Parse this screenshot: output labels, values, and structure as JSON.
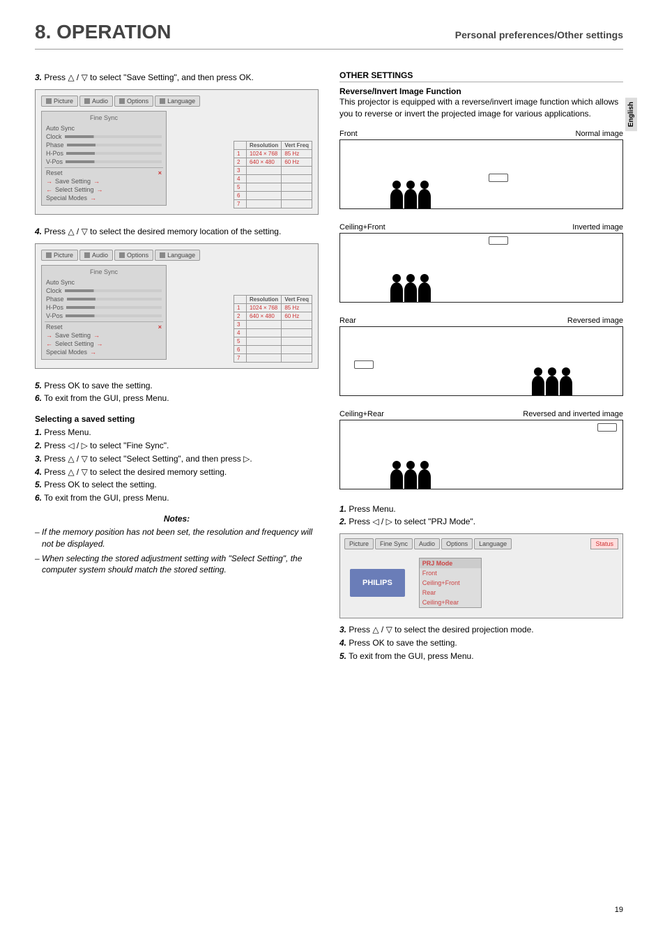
{
  "header": {
    "chapter": "8. OPERATION",
    "section": "Personal preferences/Other settings"
  },
  "side_tab": "English",
  "left": {
    "step3": {
      "num": "3.",
      "text": "Press △ / ▽ to select \"Save Setting\", and then press OK."
    },
    "step4": {
      "num": "4.",
      "text": "Press △ / ▽ to select the desired memory location of the setting."
    },
    "step5": {
      "num": "5.",
      "text": "Press OK to save the setting."
    },
    "step6": {
      "num": "6.",
      "text": "To exit from the GUI, press Menu."
    },
    "selecting_heading": "Selecting a saved setting",
    "sel1": {
      "num": "1.",
      "text": "Press Menu."
    },
    "sel2": {
      "num": "2.",
      "text": "Press ◁ / ▷ to select \"Fine Sync\"."
    },
    "sel3": {
      "num": "3.",
      "text": "Press △ / ▽ to select \"Select Setting\", and then press ▷."
    },
    "sel4": {
      "num": "4.",
      "text": "Press △ / ▽ to select the desired memory setting."
    },
    "sel5": {
      "num": "5.",
      "text": "Press OK to select the setting."
    },
    "sel6": {
      "num": "6.",
      "text": "To exit from the GUI, press Menu."
    },
    "notes_title": "Notes:",
    "note1": "– If the memory position has not been set, the resolution and frequency will not be displayed.",
    "note2": "– When selecting the stored adjustment setting with \"Select Setting\", the computer system should match the stored setting."
  },
  "osd": {
    "tabs": [
      "Picture",
      "Audio",
      "Options",
      "Language"
    ],
    "panel_title": "Fine Sync",
    "rows": [
      "Auto Sync",
      "Clock",
      "Phase",
      "H-Pos",
      "V-Pos",
      "Reset",
      "Save Setting",
      "Select Setting",
      "Special Modes"
    ],
    "res_headers": [
      "Resolution",
      "Vert Freq"
    ],
    "res_rows": [
      {
        "n": "1",
        "res": "1024 × 768",
        "freq": "85 Hz"
      },
      {
        "n": "2",
        "res": "640 × 480",
        "freq": "60 Hz"
      },
      {
        "n": "3",
        "res": "",
        "freq": ""
      },
      {
        "n": "4",
        "res": "",
        "freq": ""
      },
      {
        "n": "5",
        "res": "",
        "freq": ""
      },
      {
        "n": "6",
        "res": "",
        "freq": ""
      },
      {
        "n": "7",
        "res": "",
        "freq": ""
      }
    ]
  },
  "right": {
    "other_heading": "OTHER SETTINGS",
    "reverse_heading": "Reverse/Invert Image Function",
    "reverse_desc": "This projector is equipped with a reverse/invert image function which allows you to reverse or invert the projected image for various applications.",
    "modes": [
      {
        "left": "Front",
        "right": "Normal image"
      },
      {
        "left": "Ceiling+Front",
        "right": "Inverted image"
      },
      {
        "left": "Rear",
        "right": "Reversed image"
      },
      {
        "left": "Ceiling+Rear",
        "right": "Reversed and inverted image"
      }
    ],
    "r1": {
      "num": "1.",
      "text": "Press Menu."
    },
    "r2": {
      "num": "2.",
      "text": "Press ◁ / ▷ to select \"PRJ Mode\"."
    },
    "r3": {
      "num": "3.",
      "text": "Press △ / ▽ to select the desired projection mode."
    },
    "r4": {
      "num": "4.",
      "text": "Press OK to save the setting."
    },
    "r5": {
      "num": "5.",
      "text": "To exit from the GUI, press Menu."
    }
  },
  "osd2": {
    "tabs": [
      "Picture",
      "Fine Sync",
      "Audio",
      "Options",
      "Language"
    ],
    "status": "Status",
    "logo": "PHILIPS",
    "menu_title": "PRJ Mode",
    "menu_items": [
      "Front",
      "Ceiling+Front",
      "Rear",
      "Ceiling+Rear"
    ]
  },
  "page_number": "19"
}
